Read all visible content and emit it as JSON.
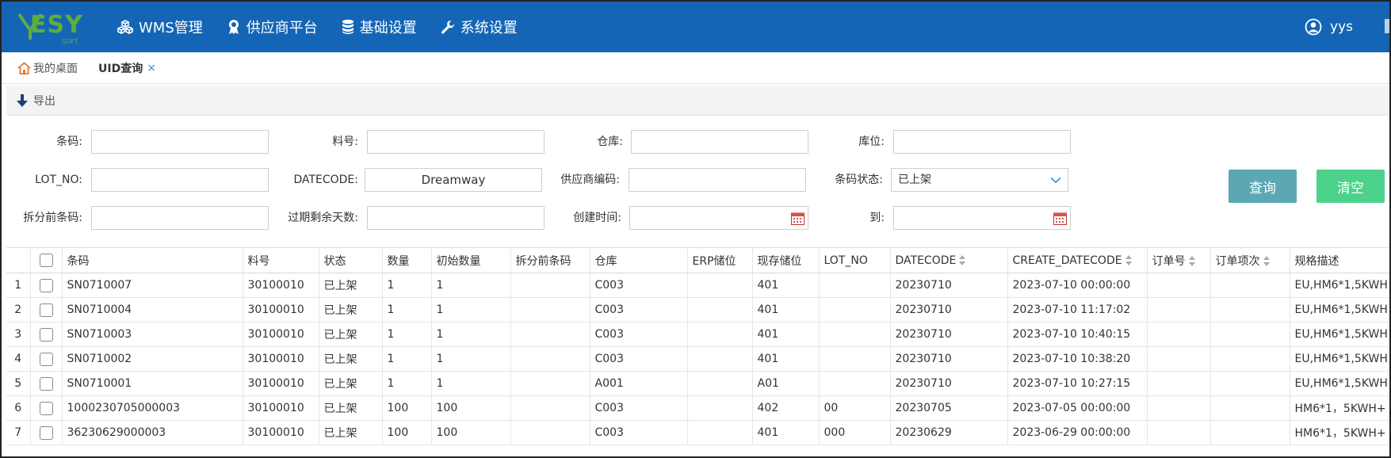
{
  "header": {
    "logo_text": "ESY",
    "logo_sub": "SOFT",
    "nav": [
      {
        "label": "WMS管理",
        "icon": "cubes-icon"
      },
      {
        "label": "供应商平台",
        "icon": "award-icon"
      },
      {
        "label": "基础设置",
        "icon": "database-icon"
      },
      {
        "label": "系统设置",
        "icon": "wrench-icon"
      }
    ],
    "user": "yys"
  },
  "tabs": [
    {
      "label": "我的桌面"
    },
    {
      "label": "UID查询",
      "close": "×"
    }
  ],
  "toolbar": {
    "export_label": "导出"
  },
  "form": {
    "barcode_label": "条码:",
    "partno_label": "料号:",
    "warehouse_label": "仓库:",
    "location_label": "库位:",
    "lotno_label": "LOT_NO:",
    "datecode_label": "DATECODE:",
    "datecode_value": "Dreamway",
    "supplier_label": "供应商编码:",
    "status_label": "条码状态:",
    "status_value": "已上架",
    "presplit_label": "拆分前条码:",
    "expiry_label": "过期剩余天数:",
    "created_label": "创建时间:",
    "to_label": "到:",
    "query_button": "查询",
    "clear_button": "清空"
  },
  "table": {
    "columns": [
      "条码",
      "料号",
      "状态",
      "数量",
      "初始数量",
      "拆分前条码",
      "仓库",
      "ERP储位",
      "现存储位",
      "LOT_NO",
      "DATECODE",
      "CREATE_DATECODE",
      "订单号",
      "订单项次",
      "规格描述"
    ],
    "rows": [
      {
        "n": "1",
        "cells": [
          "SN0710007",
          "30100010",
          "已上架",
          "1",
          "1",
          "",
          "C003",
          "",
          "401",
          "",
          "20230710",
          "2023-07-10 00:00:00",
          "",
          "",
          "EU,HM6*1,5KWH"
        ]
      },
      {
        "n": "2",
        "cells": [
          "SN0710004",
          "30100010",
          "已上架",
          "1",
          "1",
          "",
          "C003",
          "",
          "401",
          "",
          "20230710",
          "2023-07-10 11:17:02",
          "",
          "",
          "EU,HM6*1,5KWH"
        ]
      },
      {
        "n": "3",
        "cells": [
          "SN0710003",
          "30100010",
          "已上架",
          "1",
          "1",
          "",
          "C003",
          "",
          "401",
          "",
          "20230710",
          "2023-07-10 10:40:15",
          "",
          "",
          "EU,HM6*1,5KWH"
        ]
      },
      {
        "n": "4",
        "cells": [
          "SN0710002",
          "30100010",
          "已上架",
          "1",
          "1",
          "",
          "C003",
          "",
          "401",
          "",
          "20230710",
          "2023-07-10 10:38:20",
          "",
          "",
          "EU,HM6*1,5KWH"
        ]
      },
      {
        "n": "5",
        "cells": [
          "SN0710001",
          "30100010",
          "已上架",
          "1",
          "1",
          "",
          "A001",
          "",
          "A01",
          "",
          "20230710",
          "2023-07-10 10:27:15",
          "",
          "",
          "EU,HM6*1,5KWH"
        ]
      },
      {
        "n": "6",
        "cells": [
          "1000230705000003",
          "30100010",
          "已上架",
          "100",
          "100",
          "",
          "C003",
          "",
          "402",
          "00",
          "20230705",
          "2023-07-05 00:00:00",
          "",
          "",
          "HM6*1，5KWH+"
        ]
      },
      {
        "n": "7",
        "cells": [
          "36230629000003",
          "30100010",
          "已上架",
          "100",
          "100",
          "",
          "C003",
          "",
          "401",
          "000",
          "20230629",
          "2023-06-29 00:00:00",
          "",
          "",
          "HM6*1，5KWH+"
        ]
      }
    ]
  },
  "colors": {
    "header_bg": "#1565b6",
    "query_btn": "#5ba8b4",
    "clear_btn": "#4cd28a",
    "logo": "#5fae3d"
  }
}
